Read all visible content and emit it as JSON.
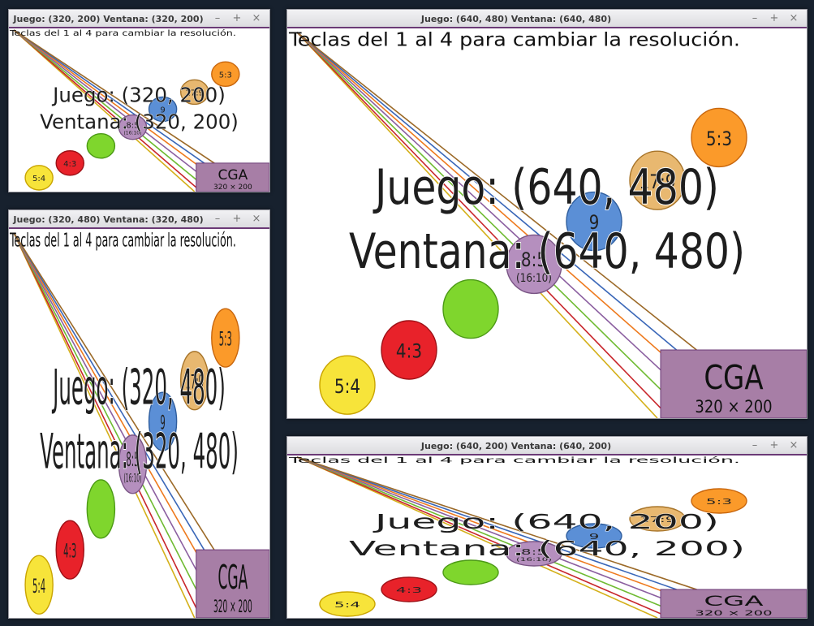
{
  "windows": [
    {
      "id": "w1",
      "title": "Juego: (320, 200) Ventana: (320, 200)",
      "hint": "Teclas del 1 al 4 para cambiar la resolución.",
      "game_line": "Juego: (320, 200)",
      "window_line": "Ventana: (320, 200)",
      "badge_title": "CGA",
      "badge_sub": "320 × 200"
    },
    {
      "id": "w2",
      "title": "Juego: (320, 480) Ventana: (320, 480)",
      "hint": "Teclas del 1 al 4 para cambiar la resolución.",
      "game_line": "Juego: (320, 480)",
      "window_line": "Ventana: (320, 480)",
      "badge_title": "CGA",
      "badge_sub": "320 × 200"
    },
    {
      "id": "w3",
      "title": "Juego: (640, 480) Ventana: (640, 480)",
      "hint": "Teclas del 1 al 4 para cambiar la resolución.",
      "game_line": "Juego: (640, 480)",
      "window_line": "Ventana: (640, 480)",
      "badge_title": "CGA",
      "badge_sub": "320 × 200"
    },
    {
      "id": "w4",
      "title": "Juego: (640, 200) Ventana: (640, 200)",
      "hint": "Teclas del 1 al 4 para cambiar la resolución.",
      "game_line": "Juego: (640, 200)",
      "window_line": "Ventana: (640, 200)",
      "badge_title": "CGA",
      "badge_sub": "320 × 200"
    }
  ],
  "controls": {
    "minimize": "–",
    "maximize": "+",
    "close": "×"
  },
  "circles": [
    {
      "label": "5:4",
      "fill": "#f7e43a",
      "stroke": "#c9a400"
    },
    {
      "label": "4:3",
      "fill": "#e8222a",
      "stroke": "#9e1016"
    },
    {
      "label": "",
      "fill": "#7fd62d",
      "stroke": "#4c9a16"
    },
    {
      "label": "8:5",
      "sub": "(16:10)",
      "fill": "#b58fbe",
      "stroke": "#7a5585"
    },
    {
      "label": "9",
      "fill": "#5b8fd6",
      "stroke": "#2f5e9e"
    },
    {
      "label": "17:9",
      "fill": "#e8b870",
      "stroke": "#a8752a"
    },
    {
      "label": "5:3",
      "fill": "#fb9a2a",
      "stroke": "#c8660d"
    }
  ],
  "line_colors": [
    "#d4b01a",
    "#c8262c",
    "#6fbb32",
    "#8b5fa0",
    "#ee7a1e",
    "#3a67b8",
    "#9c6a28"
  ],
  "colors": {
    "desktop": "#17212e",
    "badge": "#a77ea6",
    "accent": "#6b3a76"
  }
}
